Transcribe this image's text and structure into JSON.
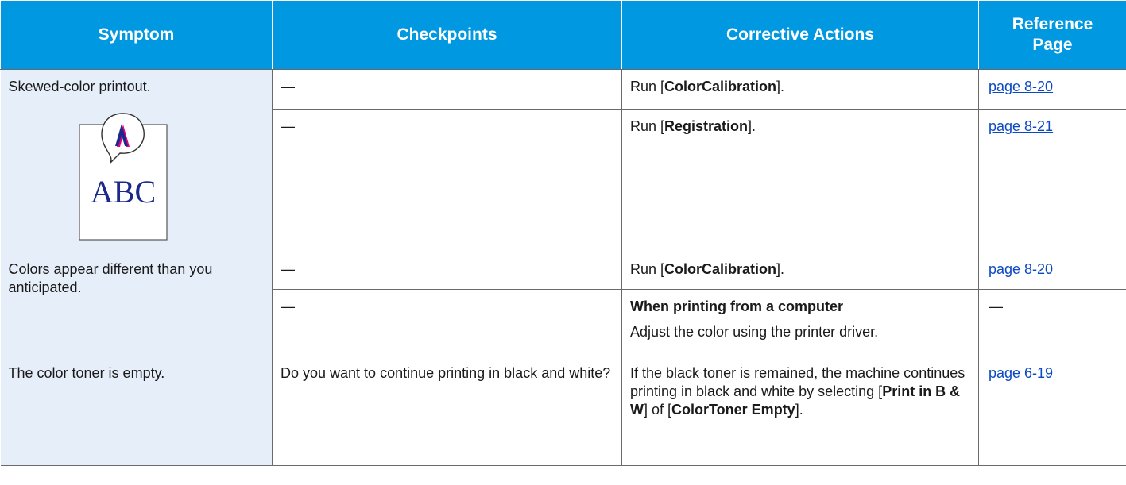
{
  "headers": {
    "symptom": "Symptom",
    "checkpoints": "Checkpoints",
    "corrective_actions": "Corrective Actions",
    "reference_page": [
      "Reference",
      "Page"
    ]
  },
  "rows": [
    {
      "symptom": "Skewed-color printout.",
      "illustration_text": "ABC",
      "checkpoint_1": "—",
      "action_1": {
        "pre": "Run [",
        "bold": "ColorCalibration",
        "post": "]."
      },
      "ref_1": "page 8-20",
      "checkpoint_2": "—",
      "action_2": {
        "pre": "Run [",
        "bold": "Registration",
        "post": "]."
      },
      "ref_2": "page 8-21"
    },
    {
      "symptom": "Colors appear different than you anticipated.",
      "checkpoint_1": "—",
      "action_1": {
        "pre": "Run [",
        "bold": "ColorCalibration",
        "post": "]."
      },
      "ref_1": "page 8-20",
      "checkpoint_2": "—",
      "action_2": {
        "heading": "When printing from a computer",
        "text": "Adjust the color using the printer driver."
      },
      "ref_2": "—"
    },
    {
      "symptom": "The color toner is empty.",
      "checkpoint": "Do you want to continue printing in black and white?",
      "action": {
        "t1": "If the black toner is remained, the machine continues printing in black and white by selecting [",
        "b1": "Print in B & W",
        "t2": "] of [",
        "b2": "ColorToner Empty",
        "t3": "]."
      },
      "ref": "page 6-19"
    }
  ],
  "colors": {
    "header_bg": "#0098e1",
    "symptom_bg": "#e6eef9",
    "link": "#0a48c4",
    "illustration_text": "#1b2a8a",
    "illustration_accent": "#e6007e"
  }
}
